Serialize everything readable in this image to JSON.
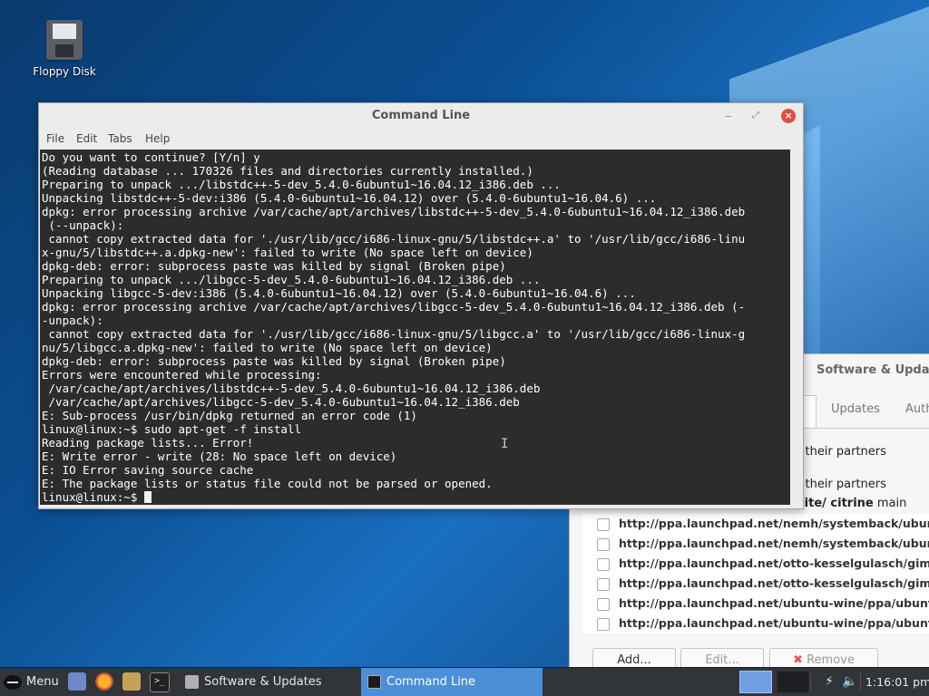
{
  "desktop": {
    "icons": [
      {
        "label": "Floppy Disk",
        "icon": "floppy-disk-icon"
      }
    ]
  },
  "software_updates_window": {
    "title": "Software & Updat",
    "tabs": [
      "Updates",
      "Auth"
    ],
    "partner_lines": [
      "r their partners",
      "r their partners"
    ],
    "source_fragment": {
      "prefix": "tlite/ citrine",
      "suffix": " main"
    },
    "sources": [
      "http://ppa.launchpad.net/nemh/systemback/ubuntu xe",
      "http://ppa.launchpad.net/nemh/systemback/ubuntu xe",
      "http://ppa.launchpad.net/otto-kesselgulasch/gimp/ubu",
      "http://ppa.launchpad.net/otto-kesselgulasch/gimp/ubu",
      "http://ppa.launchpad.net/ubuntu-wine/ppa/ubuntu xen",
      "http://ppa.launchpad.net/ubuntu-wine/ppa/ubuntu xen"
    ],
    "buttons": {
      "add": "Add...",
      "edit": "Edit...",
      "remove": "Remove"
    }
  },
  "terminal_window": {
    "title": "Command Line",
    "menu": [
      "File",
      "Edit",
      "Tabs",
      "Help"
    ],
    "lines": [
      "Do you want to continue? [Y/n] y",
      "(Reading database ... 170326 files and directories currently installed.)",
      "Preparing to unpack .../libstdc++-5-dev_5.4.0-6ubuntu1~16.04.12_i386.deb ...",
      "Unpacking libstdc++-5-dev:i386 (5.4.0-6ubuntu1~16.04.12) over (5.4.0-6ubuntu1~16.04.6) ...",
      "dpkg: error processing archive /var/cache/apt/archives/libstdc++-5-dev_5.4.0-6ubuntu1~16.04.12_i386.deb",
      " (--unpack):",
      " cannot copy extracted data for './usr/lib/gcc/i686-linux-gnu/5/libstdc++.a' to '/usr/lib/gcc/i686-linu",
      "x-gnu/5/libstdc++.a.dpkg-new': failed to write (No space left on device)",
      "dpkg-deb: error: subprocess paste was killed by signal (Broken pipe)",
      "Preparing to unpack .../libgcc-5-dev_5.4.0-6ubuntu1~16.04.12_i386.deb ...",
      "Unpacking libgcc-5-dev:i386 (5.4.0-6ubuntu1~16.04.12) over (5.4.0-6ubuntu1~16.04.6) ...",
      "dpkg: error processing archive /var/cache/apt/archives/libgcc-5-dev_5.4.0-6ubuntu1~16.04.12_i386.deb (-",
      "-unpack):",
      " cannot copy extracted data for './usr/lib/gcc/i686-linux-gnu/5/libgcc.a' to '/usr/lib/gcc/i686-linux-g",
      "nu/5/libgcc.a.dpkg-new': failed to write (No space left on device)",
      "dpkg-deb: error: subprocess paste was killed by signal (Broken pipe)",
      "Errors were encountered while processing:",
      " /var/cache/apt/archives/libstdc++-5-dev_5.4.0-6ubuntu1~16.04.12_i386.deb",
      " /var/cache/apt/archives/libgcc-5-dev_5.4.0-6ubuntu1~16.04.12_i386.deb",
      "E: Sub-process /usr/bin/dpkg returned an error code (1)",
      "linux@linux:~$ sudo apt-get -f install",
      "Reading package lists... Error!",
      "E: Write error - write (28: No space left on device)",
      "E: IO Error saving source cache",
      "E: The package lists or status file could not be parsed or opened."
    ],
    "prompt": "linux@linux:~$ "
  },
  "taskbar": {
    "menu_label": "Menu",
    "tasks": [
      "Software & Updates",
      "Command Line"
    ],
    "active_task": "Command Line",
    "clock": "1:16:01 pm",
    "accent": "#4b8fd8"
  }
}
